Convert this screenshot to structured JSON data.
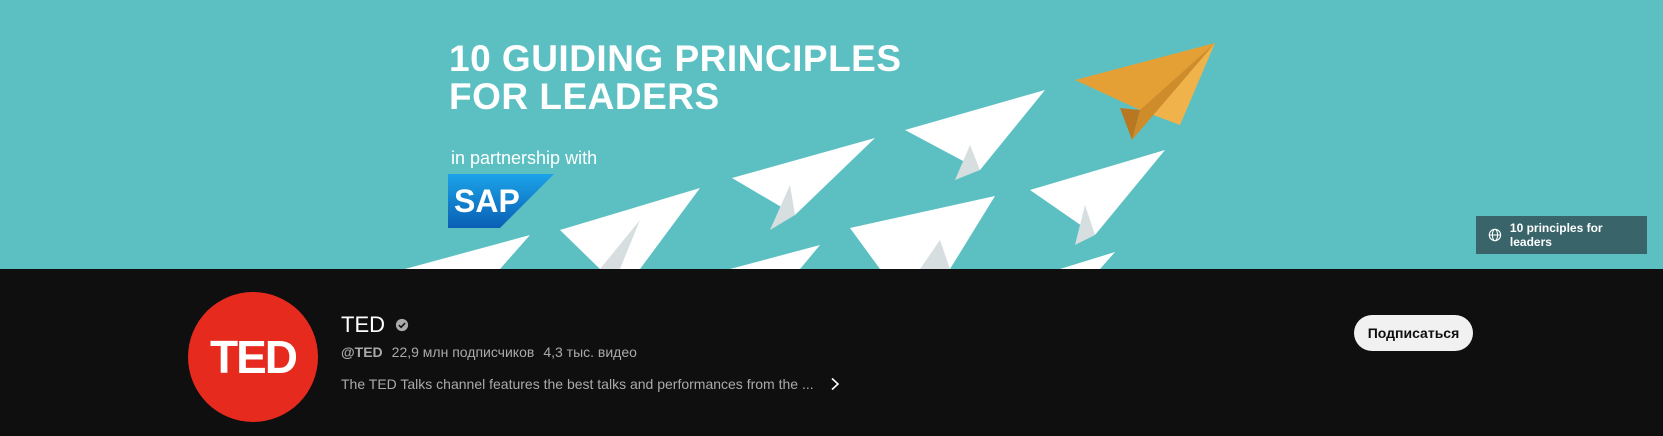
{
  "banner": {
    "headline_line1": "10 GUIDING PRINCIPLES",
    "headline_line2": "FOR LEADERS",
    "partner_text": "in partnership with",
    "partner_logo_text": "SAP",
    "link_label": "10 principles for leaders",
    "link_icon": "globe-icon",
    "colors": {
      "background": "#5cc0c3",
      "accent_plane": "#e5a035",
      "sap_blue": "#0a6ed1"
    }
  },
  "channel": {
    "avatar_text": "TED",
    "name": "TED",
    "verified_icon": "verified-check-icon",
    "handle": "@TED",
    "subscribers": "22,9 млн подписчиков",
    "videos": "4,3 тыс. видео",
    "description": "The TED Talks channel features the best talks and performances from the ...",
    "description_more_icon": "chevron-right-icon",
    "subscribe_label": "Подписаться",
    "colors": {
      "avatar_red": "#e62b1e",
      "page_background": "#0f0f0f"
    }
  }
}
